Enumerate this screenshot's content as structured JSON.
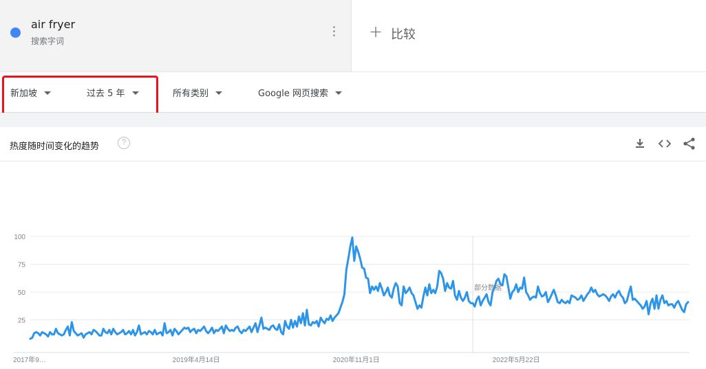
{
  "search_term": {
    "title": "air fryer",
    "subtitle": "搜索字词",
    "dot_color": "#4285f4"
  },
  "compare": {
    "plus": "+",
    "label": "比较"
  },
  "filters": {
    "region": "新加坡",
    "time": "过去 5 年",
    "category": "所有类别",
    "search_type": "Google 网页搜索"
  },
  "chart_header": {
    "title": "热度随时间变化的趋势",
    "help": "?"
  },
  "icons": [
    "more-vert-icon",
    "download-icon",
    "embed-icon",
    "share-icon",
    "help-icon"
  ],
  "hover_label": "部分数据",
  "chart_data": {
    "type": "line",
    "title": "",
    "xlabel": "",
    "ylabel": "",
    "ylim": [
      0,
      100
    ],
    "yticks": [
      25,
      50,
      75,
      100
    ],
    "xtick_labels": [
      "2017年9…",
      "2019年4月14日",
      "2020年11月1日",
      "2022年5月22日"
    ],
    "xtick_dates": [
      "2017-09-03",
      "2019-04-14",
      "2020-11-01",
      "2022-05-22"
    ],
    "series_color": "#2d95e8",
    "partial_data_from": "2021-12-19",
    "grid": true,
    "series": [
      {
        "x_start": "2017-09-03",
        "x_step_days": 7,
        "values": [
          8,
          9,
          13,
          14,
          13,
          11,
          14,
          13,
          12,
          10,
          14,
          12,
          12,
          17,
          13,
          12,
          11,
          12,
          16,
          19,
          11,
          23,
          15,
          13,
          11,
          12,
          13,
          9,
          12,
          13,
          14,
          12,
          16,
          15,
          13,
          11,
          11,
          17,
          14,
          13,
          16,
          12,
          17,
          14,
          12,
          13,
          14,
          16,
          12,
          13,
          15,
          12,
          16,
          11,
          14,
          20,
          12,
          13,
          14,
          12,
          15,
          14,
          12,
          16,
          12,
          13,
          14,
          11,
          22,
          13,
          14,
          16,
          11,
          17,
          15,
          12,
          14,
          16,
          18,
          17,
          18,
          14,
          16,
          17,
          13,
          16,
          15,
          17,
          19,
          15,
          13,
          15,
          18,
          13,
          16,
          15,
          17,
          19,
          13,
          20,
          17,
          15,
          16,
          15,
          18,
          19,
          15,
          13,
          16,
          15,
          17,
          19,
          14,
          18,
          22,
          14,
          20,
          27,
          17,
          18,
          17,
          16,
          19,
          20,
          17,
          16,
          21,
          14,
          12,
          24,
          19,
          17,
          25,
          18,
          24,
          19,
          28,
          22,
          31,
          20,
          34,
          21,
          20,
          23,
          22,
          24,
          19,
          27,
          24,
          22,
          26,
          25,
          29,
          24,
          27,
          29,
          31,
          36,
          41,
          48,
          70,
          80,
          91,
          99,
          78,
          91,
          86,
          80,
          72,
          71,
          63,
          62,
          49,
          55,
          52,
          55,
          51,
          58,
          53,
          47,
          50,
          54,
          47,
          45,
          53,
          58,
          55,
          40,
          38,
          55,
          49,
          51,
          54,
          49,
          47,
          41,
          35,
          38,
          36,
          46,
          54,
          47,
          57,
          49,
          52,
          49,
          55,
          69,
          67,
          62,
          51,
          58,
          54,
          53,
          60,
          47,
          43,
          51,
          45,
          42,
          45,
          50,
          42,
          40,
          40,
          37,
          43,
          46,
          38,
          42,
          45,
          48,
          41,
          38,
          50,
          54,
          60,
          62,
          57,
          56,
          66,
          64,
          54,
          44,
          50,
          52,
          57,
          50,
          54,
          53,
          63,
          50,
          47,
          43,
          45,
          46,
          45,
          55,
          49,
          46,
          47,
          50,
          41,
          44,
          48,
          52,
          47,
          41,
          40,
          43,
          41,
          40,
          42,
          40,
          47,
          46,
          45,
          43,
          44,
          47,
          42,
          45,
          48,
          50,
          54,
          50,
          52,
          48,
          46,
          47,
          48,
          47,
          45,
          42,
          46,
          48,
          45,
          49,
          51,
          47,
          45,
          40,
          42,
          49,
          55,
          43,
          44,
          42,
          40,
          38,
          35,
          37,
          42,
          30,
          40,
          44,
          35,
          47,
          35,
          43,
          47,
          40,
          42,
          38,
          39,
          39,
          36,
          40,
          42,
          38,
          34,
          32,
          39,
          41
        ]
      }
    ]
  }
}
